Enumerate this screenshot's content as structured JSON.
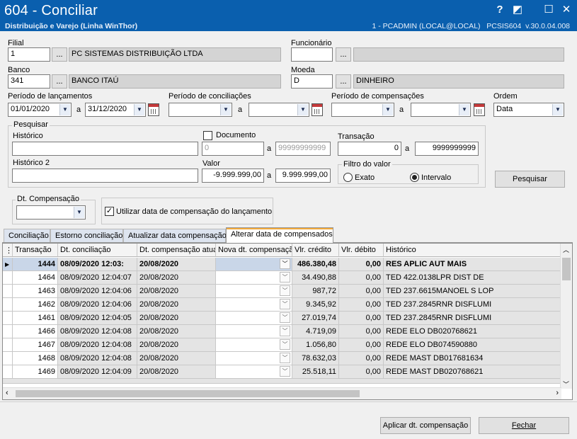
{
  "window": {
    "title": "604 - Conciliar",
    "subtitle": "Distribuição e Varejo (Linha WinThor)",
    "connection": "1 - PCADMIN (LOCAL@LOCAL)   PCSIS604  v.30.0.04.008",
    "controls": {
      "help": "?",
      "restore": "◩",
      "maximize": "☐",
      "close": "✕"
    }
  },
  "filial": {
    "label": "Filial",
    "code": "1",
    "name": "PC SISTEMAS DISTRIBUIÇÃO LTDA",
    "lookup": "..."
  },
  "funcionario": {
    "label": "Funcionário",
    "code": "",
    "name": "",
    "lookup": "..."
  },
  "banco": {
    "label": "Banco",
    "code": "341",
    "name": "BANCO ITAÚ",
    "lookup": "..."
  },
  "moeda": {
    "label": "Moeda",
    "code": "D",
    "name": "DINHEIRO",
    "lookup": "..."
  },
  "periodo_lancamentos": {
    "label": "Período de lançamentos",
    "from": "01/01/2020",
    "to": "31/12/2020",
    "sep": "a"
  },
  "periodo_conciliacoes": {
    "label": "Período de conciliações",
    "from": "",
    "to": "",
    "sep": "a"
  },
  "periodo_compensacoes": {
    "label": "Período de compensações",
    "from": "",
    "to": "",
    "sep": "a"
  },
  "ordem": {
    "label": "Ordem",
    "value": "Data"
  },
  "pesquisar": {
    "group_label": "Pesquisar",
    "historico_label": "Histórico",
    "historico_value": "",
    "historico2_label": "Histórico 2",
    "historico2_value": "",
    "documento_label": "Documento",
    "documento_from": "0",
    "documento_to": "99999999999",
    "sep": "a",
    "transacao_label": "Transação",
    "transacao_from": "0",
    "transacao_to": "9999999999",
    "valor_label": "Valor",
    "valor_from": "-9.999.999,00",
    "valor_to": "9.999.999,00",
    "filtro_label": "Filtro do valor",
    "filtro_exato": "Exato",
    "filtro_intervalo": "Intervalo",
    "button": "Pesquisar"
  },
  "dt_compensacao": {
    "label": "Dt. Compensação",
    "value": ""
  },
  "utilizar_data": {
    "label": "Utilizar data de compensação do lançamento",
    "checked": "✓"
  },
  "tabs": [
    {
      "label": "Conciliação"
    },
    {
      "label": "Estorno conciliação"
    },
    {
      "label": "Atualizar data compensação"
    },
    {
      "label": "Alterar data de compensados"
    }
  ],
  "grid": {
    "indicator_header": "⋮",
    "columns": [
      "Transação",
      "Dt. conciliação",
      "Dt. compensação atua",
      "Nova dt. compensaçã",
      "Vlr. crédito",
      "Vlr. débito",
      "Histórico"
    ],
    "rows": [
      {
        "transacao": "1444",
        "dt_conc": "08/09/2020 12:03:",
        "dt_comp": "20/08/2020",
        "credito": "486.380,48",
        "debito": "0,00",
        "historico": "RES APLIC AUT MAIS",
        "selected": true
      },
      {
        "transacao": "1464",
        "dt_conc": "08/09/2020 12:04:07",
        "dt_comp": "20/08/2020",
        "credito": "34.490,88",
        "debito": "0,00",
        "historico": "TED 422.0138LPR DIST DE"
      },
      {
        "transacao": "1463",
        "dt_conc": "08/09/2020 12:04:06",
        "dt_comp": "20/08/2020",
        "credito": "987,72",
        "debito": "0,00",
        "historico": "TED 237.6615MANOEL S LOP"
      },
      {
        "transacao": "1462",
        "dt_conc": "08/09/2020 12:04:06",
        "dt_comp": "20/08/2020",
        "credito": "9.345,92",
        "debito": "0,00",
        "historico": "TED 237.2845RNR DISFLUMI"
      },
      {
        "transacao": "1461",
        "dt_conc": "08/09/2020 12:04:05",
        "dt_comp": "20/08/2020",
        "credito": "27.019,74",
        "debito": "0,00",
        "historico": "TED 237.2845RNR DISFLUMI"
      },
      {
        "transacao": "1466",
        "dt_conc": "08/09/2020 12:04:08",
        "dt_comp": "20/08/2020",
        "credito": "4.719,09",
        "debito": "0,00",
        "historico": "REDE  ELO  DB020768621"
      },
      {
        "transacao": "1467",
        "dt_conc": "08/09/2020 12:04:08",
        "dt_comp": "20/08/2020",
        "credito": "1.056,80",
        "debito": "0,00",
        "historico": "REDE  ELO  DB074590880"
      },
      {
        "transacao": "1468",
        "dt_conc": "08/09/2020 12:04:08",
        "dt_comp": "20/08/2020",
        "credito": "78.632,03",
        "debito": "0,00",
        "historico": "REDE  MAST DB017681634"
      },
      {
        "transacao": "1469",
        "dt_conc": "08/09/2020 12:04:09",
        "dt_comp": "20/08/2020",
        "credito": "25.518,11",
        "debito": "0,00",
        "historico": "REDE  MAST DB020768621"
      }
    ]
  },
  "footer": {
    "aplicar": "Aplicar dt. compensação",
    "fechar": "Fechar"
  }
}
